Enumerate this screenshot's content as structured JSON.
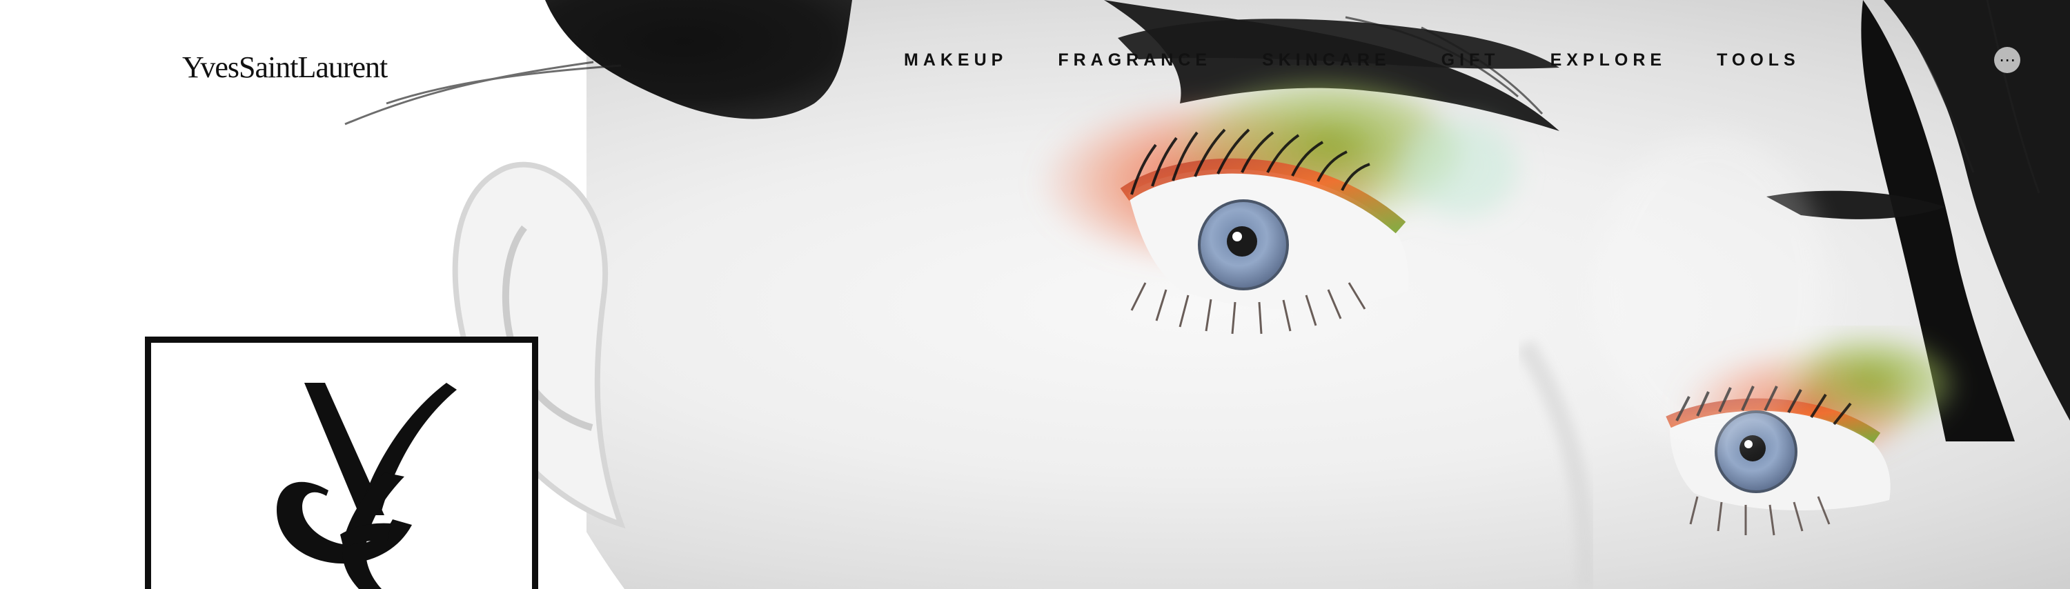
{
  "window": {
    "title": "YVES SAINT LAURENT"
  },
  "brand": {
    "name": "YVES SAINT LAURENT",
    "short": "YvesSaintLaurent"
  },
  "nav": {
    "items": [
      {
        "label": "MAKEUP"
      },
      {
        "label": "FRAGRANCE"
      },
      {
        "label": "SKINCARE"
      },
      {
        "label": "GIFT"
      },
      {
        "label": "EXPLORE"
      },
      {
        "label": "TOOLS"
      }
    ]
  },
  "hero": {
    "alt": "close-up portrait",
    "monogram": "YSL"
  },
  "colors": {
    "text": "#111111",
    "background": "#ffffff",
    "eyeshadow_red": "#d94022",
    "eyeshadow_green": "#8cab2f",
    "eye_blue": "#8fa4c2"
  }
}
